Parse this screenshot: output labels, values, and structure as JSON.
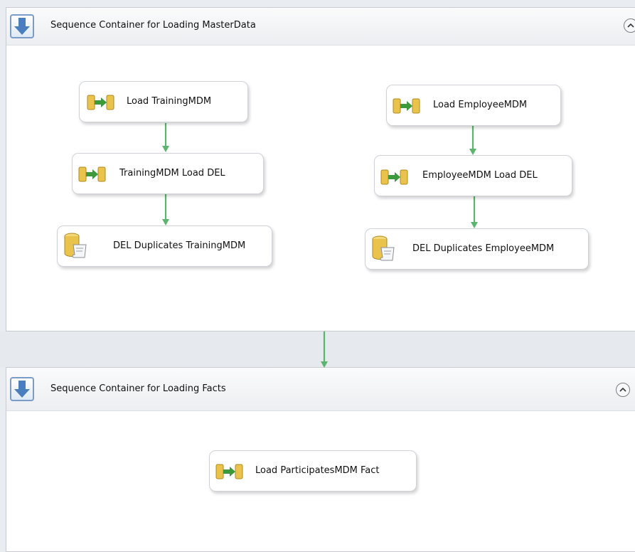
{
  "containers": [
    {
      "id": "masterdata",
      "title": "Sequence Container for Loading MasterData",
      "icon": "sequence-container-icon",
      "collapse_icon": "chevron-up-icon",
      "tasks": [
        {
          "label": "Load TrainingMDM",
          "icon": "data-flow-task-icon"
        },
        {
          "label": "TrainingMDM Load DEL",
          "icon": "data-flow-task-icon"
        },
        {
          "label": "DEL Duplicates TrainingMDM",
          "icon": "execute-sql-task-icon"
        },
        {
          "label": "Load EmployeeMDM",
          "icon": "data-flow-task-icon"
        },
        {
          "label": "EmployeeMDM Load DEL",
          "icon": "data-flow-task-icon"
        },
        {
          "label": "DEL Duplicates EmployeeMDM",
          "icon": "execute-sql-task-icon"
        }
      ]
    },
    {
      "id": "facts",
      "title": "Sequence Container for Loading Facts",
      "icon": "sequence-container-icon",
      "collapse_icon": "chevron-up-icon",
      "tasks": [
        {
          "label": "Load ParticipatesMDM Fact",
          "icon": "data-flow-task-icon"
        }
      ]
    }
  ],
  "colors": {
    "precedence_arrow": "#5cb46e",
    "container_border": "#c8ccd2",
    "container_icon_blue": "#4a7ebf",
    "data_flow_yellow": "#e9c34b",
    "data_flow_arrow": "#3c9a3c"
  }
}
